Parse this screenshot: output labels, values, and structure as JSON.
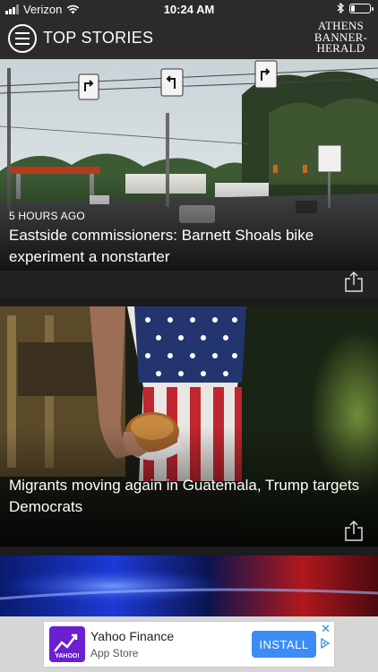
{
  "status_bar": {
    "carrier": "Verizon",
    "time": "10:24 AM",
    "icons": [
      "signal-icon",
      "wifi-icon",
      "bluetooth-icon",
      "battery-icon"
    ],
    "battery_level": 0.2
  },
  "header": {
    "title": "TOP STORIES",
    "menu_icon": "menu-icon",
    "logo_lines": [
      "ATHENS",
      "BANNER-",
      "HERALD"
    ]
  },
  "stories": [
    {
      "timestamp": "5 HOURS AGO",
      "headline": "Eastside commissioners: Barnett Shoals bike experiment a nonstarter",
      "share_icon": "share-icon"
    },
    {
      "headline": "Migrants moving again in Guatemala, Trump targets Democrats",
      "share_icon": "share-icon"
    }
  ],
  "ad": {
    "app_name": "Yahoo Finance",
    "store": "App Store",
    "brand": "YAHOO!",
    "install_label": "INSTALL",
    "close_symbol": "✕",
    "accent": "#3b8cf5",
    "logo_color": "#6a1fd1"
  }
}
